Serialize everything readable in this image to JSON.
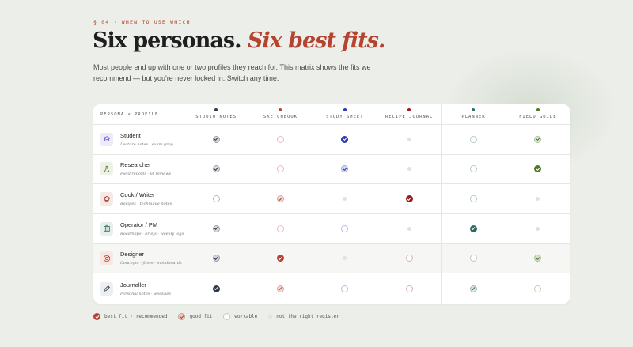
{
  "section": {
    "eyebrow": "§ 04 · WHEN TO USE WHICH",
    "title_main": "Six personas.",
    "title_accent": "Six best fits.",
    "intro": "Most people end up with one or two profiles they reach for. This matrix shows the fits we recommend — but you're never locked in. Switch any time."
  },
  "colors": {
    "accent": "#b5432f",
    "background": "#eceee9"
  },
  "matrix": {
    "corner_label": "PERSONA × PROFILE",
    "profiles": [
      {
        "label": "STUDIO NOTES",
        "color": "#2f3a4a"
      },
      {
        "label": "SKETCHBOOK",
        "color": "#b5432f"
      },
      {
        "label": "STUDY SHEET",
        "color": "#2b3bb0"
      },
      {
        "label": "RECIPE JOURNAL",
        "color": "#9b1c1c"
      },
      {
        "label": "PLANNER",
        "color": "#2e6b66"
      },
      {
        "label": "FIELD GUIDE",
        "color": "#4d7a2a"
      }
    ],
    "personas": [
      {
        "name": "Student",
        "desc": "Lecture notes · exam prep",
        "icon": "graduation-cap-icon",
        "icon_color": "#6b5bd0",
        "icon_bg": "#ecebf8",
        "fits": [
          "good",
          "workable",
          "best",
          "none",
          "workable",
          "good"
        ]
      },
      {
        "name": "Researcher",
        "desc": "Field reports · lit reviews",
        "icon": "flask-icon",
        "icon_color": "#4d7a2a",
        "icon_bg": "#eef2e6",
        "fits": [
          "good",
          "workable",
          "good",
          "none",
          "workable",
          "best"
        ]
      },
      {
        "name": "Cook / Writer",
        "desc": "Recipes · technique notes",
        "icon": "chef-hat-icon",
        "icon_color": "#9b1c1c",
        "icon_bg": "#f5e9e6",
        "fits": [
          "workable",
          "good",
          "none",
          "best",
          "workable",
          "none"
        ]
      },
      {
        "name": "Operator / PM",
        "desc": "Roadmaps · briefs · weekly logs",
        "icon": "building-icon",
        "icon_color": "#2e6b66",
        "icon_bg": "#e7efec",
        "fits": [
          "good",
          "workable",
          "workable",
          "none",
          "best",
          "none"
        ]
      },
      {
        "name": "Designer",
        "desc": "Concepts · flows · moodboards",
        "icon": "target-icon",
        "icon_color": "#b5432f",
        "icon_bg": "#f6e8e3",
        "fits": [
          "good",
          "best",
          "none",
          "workable",
          "workable",
          "good"
        ]
      },
      {
        "name": "Journaller",
        "desc": "Personal notes · weeklies",
        "icon": "pen-icon",
        "icon_color": "#2f3a4a",
        "icon_bg": "#eceef0",
        "fits": [
          "best",
          "good",
          "workable",
          "workable",
          "good",
          "workable"
        ]
      }
    ]
  },
  "legend": {
    "best": "best fit · recommended",
    "good": "good fit",
    "workable": "workable",
    "none": "not the right register"
  }
}
